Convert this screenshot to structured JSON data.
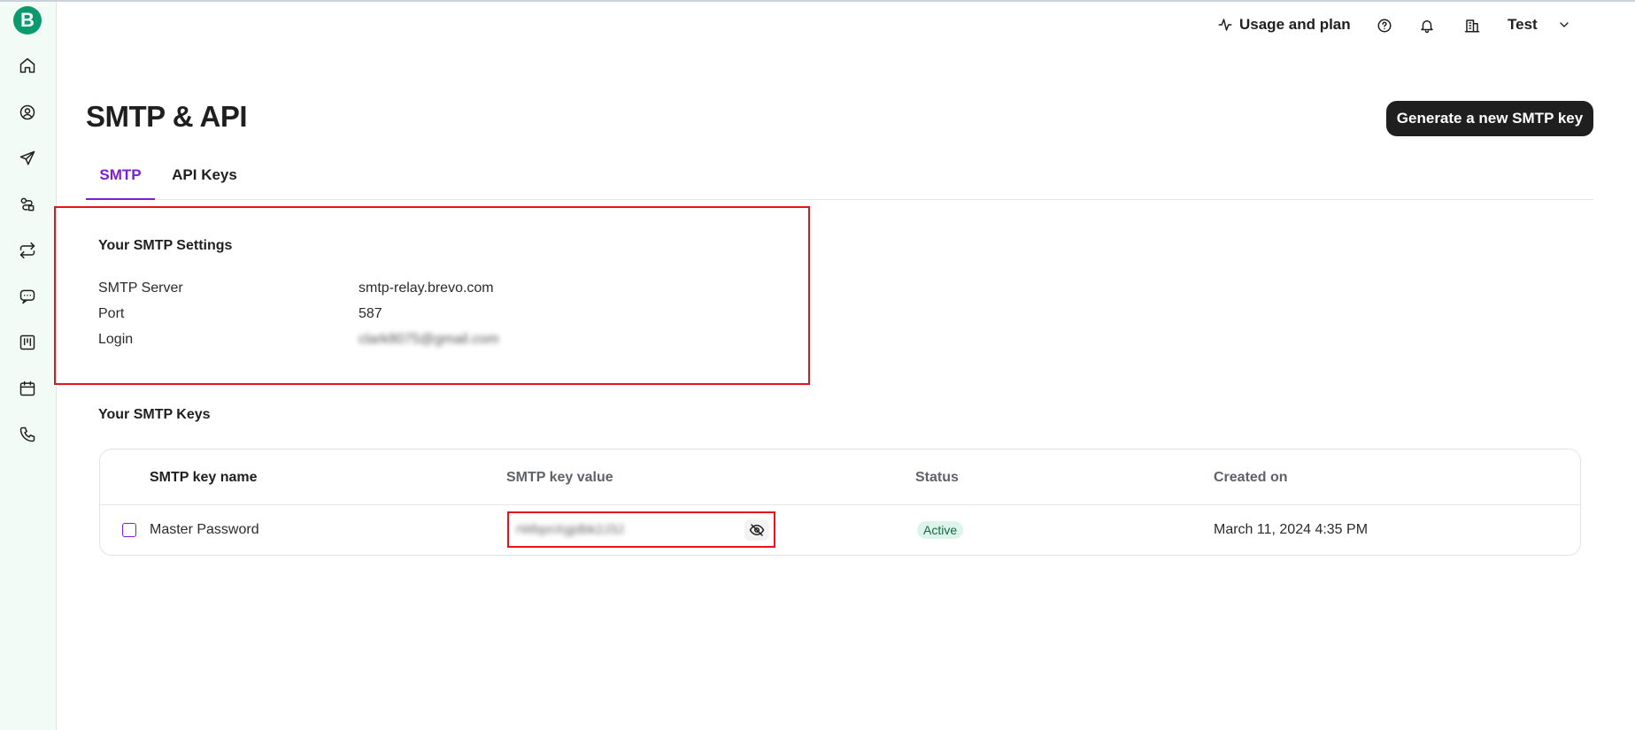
{
  "app": {
    "logo_letter": "B"
  },
  "sidebar": {
    "items": [
      {
        "icon": "home-icon"
      },
      {
        "icon": "contacts-icon"
      },
      {
        "icon": "campaigns-icon"
      },
      {
        "icon": "automations-icon"
      },
      {
        "icon": "transactional-icon"
      },
      {
        "icon": "conversations-icon"
      },
      {
        "icon": "deals-icon"
      },
      {
        "icon": "meetings-icon"
      },
      {
        "icon": "phone-icon"
      }
    ]
  },
  "header": {
    "usage_label": "Usage and plan",
    "account_name": "Test",
    "icons": [
      "activity-icon",
      "help-icon",
      "bell-icon",
      "building-icon",
      "chevron-down-icon"
    ]
  },
  "page": {
    "title": "SMTP & API",
    "generate_button": "Generate a new SMTP key"
  },
  "tabs": [
    {
      "label": "SMTP",
      "active": true
    },
    {
      "label": "API Keys",
      "active": false
    }
  ],
  "smtp_settings": {
    "title": "Your SMTP Settings",
    "rows": [
      {
        "label": "SMTP Server",
        "value": "smtp-relay.brevo.com"
      },
      {
        "label": "Port",
        "value": "587"
      },
      {
        "label": "Login",
        "value": "clark8075@gmail.com"
      }
    ]
  },
  "smtp_keys": {
    "title": "Your SMTP Keys",
    "columns": [
      "SMTP key name",
      "SMTP key value",
      "Status",
      "Created on"
    ],
    "rows": [
      {
        "name": "Master Password",
        "value": "rWbpnXgjdbk2J3J",
        "status": "Active",
        "created": "March 11, 2024 4:35 PM"
      }
    ]
  },
  "colors": {
    "accent": "#7b1fd6",
    "brand": "#0b996e",
    "highlight_border": "#e3141d",
    "status_active_bg": "#dcf4ea",
    "status_active_text": "#16664a"
  }
}
